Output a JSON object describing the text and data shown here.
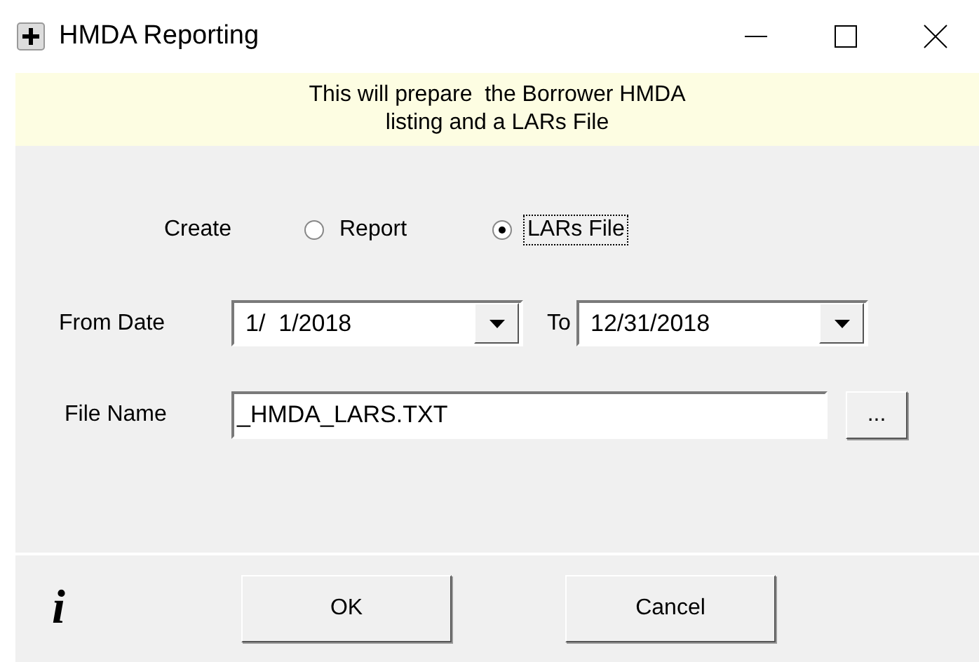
{
  "window": {
    "title": "HMDA Reporting"
  },
  "banner": {
    "lines": [
      "This will prepare  the Borrower HMDA",
      "listing and a LARs File"
    ]
  },
  "create": {
    "label": "Create",
    "options": [
      {
        "label": "Report",
        "selected": false,
        "focused": false
      },
      {
        "label": "LARs File",
        "selected": true,
        "focused": true
      }
    ]
  },
  "dates": {
    "from_label": "From Date",
    "from_value": "1/  1/2018",
    "to_label": "To",
    "to_value": "12/31/2018"
  },
  "file": {
    "label": "File Name",
    "value": "_HMDA_LARS.TXT",
    "browse": "..."
  },
  "footer": {
    "info": "i",
    "buttons": [
      "OK",
      "Cancel"
    ]
  }
}
